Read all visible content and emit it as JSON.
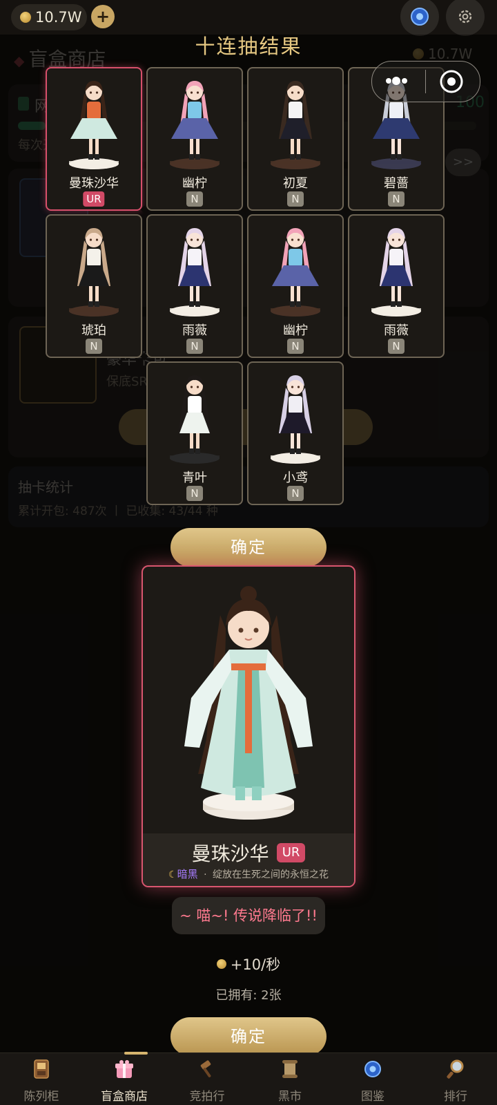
{
  "header": {
    "coins": "10.7W",
    "plus_label": "+"
  },
  "background_page": {
    "title": "盲盒商店",
    "coins": "10.7W",
    "banner_prefix": "网",
    "banner_value": "100",
    "banner_sub": "每次开",
    "arrow_label": ">>",
    "pack_sub": "保底SR",
    "pack_title": "豪华卡包",
    "stats_title": "抽卡统计",
    "stats_text": "累计开包: 487次 丨 已收集: 43/44 种"
  },
  "overlay": {
    "title": "十连抽结果",
    "confirm_label": "确定",
    "results": [
      {
        "name": "曼珠沙华",
        "rarity": "UR",
        "style": "hanfu"
      },
      {
        "name": "幽柠",
        "rarity": "N",
        "style": "pink"
      },
      {
        "name": "初夏",
        "rarity": "N",
        "style": "school"
      },
      {
        "name": "碧蔷",
        "rarity": "N",
        "style": "silver"
      },
      {
        "name": "琥珀",
        "rarity": "N",
        "style": "casual"
      },
      {
        "name": "雨薇",
        "rarity": "N",
        "style": "lolita"
      },
      {
        "name": "幽柠",
        "rarity": "N",
        "style": "pink"
      },
      {
        "name": "雨薇",
        "rarity": "N",
        "style": "lolita"
      },
      {
        "name": "青叶",
        "rarity": "N",
        "style": "sport"
      },
      {
        "name": "小鸢",
        "rarity": "N",
        "style": "gothic"
      }
    ]
  },
  "featured": {
    "name": "曼珠沙华",
    "rarity": "UR",
    "element": "暗黑",
    "separator": "·",
    "description": "绽放在生死之间的永恒之花",
    "speech": "~ 喵~! 传说降临了!!",
    "income": "+10/秒",
    "owned": "已拥有: 2张",
    "confirm_label": "确定"
  },
  "nav": {
    "items": [
      {
        "label": "陈列柜",
        "icon": "cabinet-icon"
      },
      {
        "label": "盲盒商店",
        "icon": "gift-box-icon",
        "active": true
      },
      {
        "label": "竞拍行",
        "icon": "gavel-icon"
      },
      {
        "label": "黑市",
        "icon": "scroll-icon"
      },
      {
        "label": "图鉴",
        "icon": "compass-icon"
      },
      {
        "label": "排行",
        "icon": "magnifier-icon"
      }
    ]
  },
  "colors": {
    "gold": "#c8a663",
    "ur_red": "#d14a66",
    "n_gray": "#8a8578",
    "dark_element": "#9b6bff"
  }
}
